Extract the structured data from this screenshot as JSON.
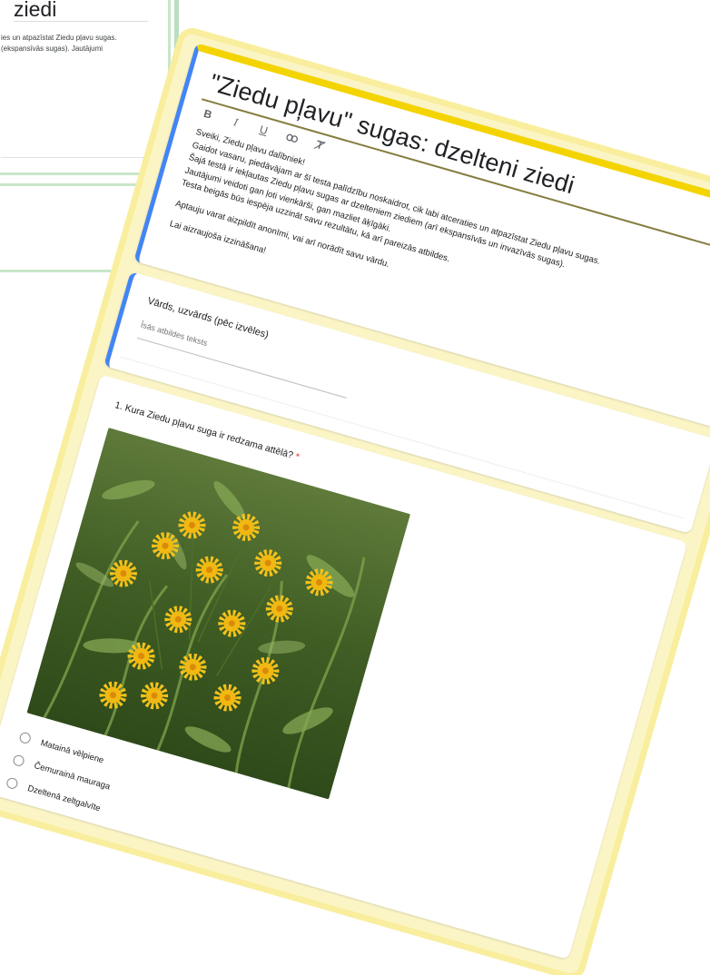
{
  "background_form": {
    "title_fragment": "ziedi",
    "description_lines": [
      "ies un atpazīstat Ziedu pļavu sugas.",
      "(ekspansīvās sugas). Jautājumi"
    ]
  },
  "form": {
    "title": "\"Ziedu pļavu\" sugas: dzelteni ziedi",
    "toolbar": [
      {
        "icon": "bold-icon",
        "glyph": "B"
      },
      {
        "icon": "italic-icon",
        "glyph": "I"
      },
      {
        "icon": "underline-icon",
        "glyph": "U"
      },
      {
        "icon": "link-icon",
        "glyph": "⊖"
      },
      {
        "icon": "clear-formatting-icon",
        "glyph": "T̸"
      }
    ],
    "description": [
      "Sveiki, Ziedu pļavu dalībniek!",
      "Gaidot vasaru, piedāvājam ar šī testa palīdzību noskaidrot, cik labi atceraties un atpazīstat Ziedu pļavu sugas.",
      "Šajā testā ir iekļautas Ziedu pļavu sugas ar dzelteniem ziediem (arī ekspansīvās un invazīvās sugas).",
      "Jautājumi veidoti gan ļoti vienkārši, gan mazliet āķīgāki.",
      "Testa beigās būs iespēja uzzināt savu rezultātu, kā arī pareizās atbildes.",
      "",
      "Aptauju varat aizpildīt anonīmi, vai arī norādīt savu vārdu.",
      "",
      "Lai aizraujoša izzināšana!"
    ]
  },
  "name_question": {
    "title": "Vārds, uzvārds (pēc izvēles)",
    "placeholder": "Īsās atbildes teksts"
  },
  "question1": {
    "title": "1. Kura Ziedu pļavu suga ir redzama attēlā?",
    "required_marker": "*",
    "options": [
      "Matainā vēlpiene",
      "Čemurainā mauraga",
      "Dzeltenā zeltgalvīte"
    ]
  },
  "colors": {
    "accent_yellow": "#f4d400",
    "header_blue": "#4285f4",
    "form_background": "#fbf5c6",
    "background_form_green": "#c8e6c9",
    "required_red": "#d93025"
  }
}
